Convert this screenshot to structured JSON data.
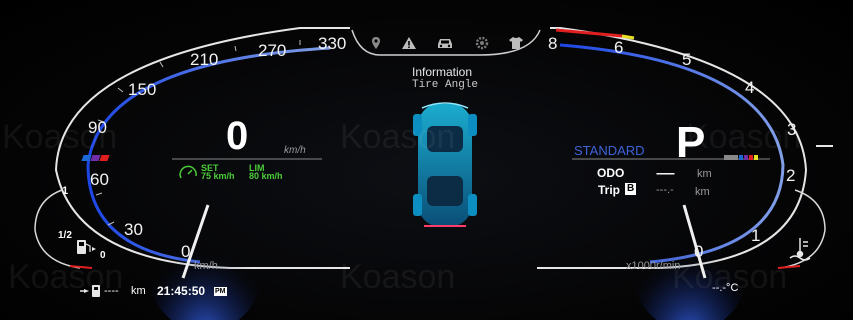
{
  "watermark": "Koason",
  "top_bar": {
    "icons": [
      "location-pin-icon",
      "warning-triangle-icon",
      "car-icon",
      "gear-icon",
      "shirt-icon"
    ]
  },
  "info_panel": {
    "title": "Information",
    "subtitle": "Tire Angle"
  },
  "speedometer": {
    "speed": "0",
    "speed_unit": "km/h",
    "scale_labels": [
      "0",
      "30",
      "60",
      "90",
      "150",
      "210",
      "270",
      "330"
    ],
    "dial_unit": "km/h",
    "cruise": {
      "set_label": "SET",
      "set_value": "75 km/h",
      "lim_label": "LIM",
      "lim_value": "80 km/h"
    }
  },
  "tachometer": {
    "scale_labels": [
      "0",
      "1",
      "2",
      "3",
      "4",
      "5",
      "6",
      "8"
    ],
    "dial_unit": "x1000r/min",
    "drive_mode": "STANDARD",
    "gear": "P",
    "odo_label": "ODO",
    "odo_value": "------",
    "odo_unit": "km",
    "trip_label": "Trip",
    "trip_id": "B",
    "trip_value": "---.-",
    "trip_unit": "km"
  },
  "fuel_gauge": {
    "full": "1",
    "half": "1/2",
    "empty": "0"
  },
  "bottom_bar": {
    "range_value": "----",
    "range_unit": "km",
    "clock": "21:45:50",
    "clock_suffix": "PM",
    "outside_temp": "--.-°C"
  },
  "colors": {
    "accent_blue": "#2f63ff",
    "redline": "#e02020",
    "cruise_green": "#4ccc3a",
    "warn_yellow": "#e8e020"
  }
}
